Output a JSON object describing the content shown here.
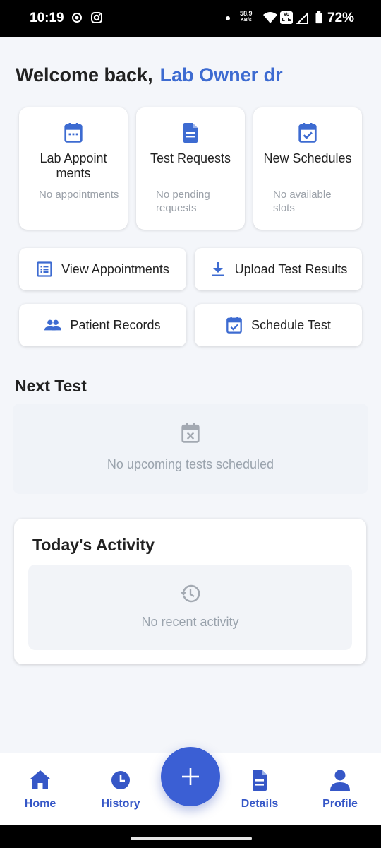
{
  "status_bar": {
    "time": "10:19",
    "net_speed_value": "58.9",
    "net_speed_unit": "KB/s",
    "volte": "Vo LTE",
    "battery": "72%"
  },
  "header": {
    "welcome_prefix": "Welcome back,",
    "user_name": "Lab Owner dr"
  },
  "stat_cards": [
    {
      "title": "Lab Appoint ments",
      "subtitle": "No appointments",
      "icon": "calendar-icon"
    },
    {
      "title": "Test Requests",
      "subtitle": "No pending requests",
      "icon": "document-icon"
    },
    {
      "title": "New Schedules",
      "subtitle": "No available slots",
      "icon": "calendar-check-icon"
    }
  ],
  "actions": [
    {
      "label": "View Appointments",
      "icon": "list-icon"
    },
    {
      "label": "Upload Test Results",
      "icon": "download-icon"
    },
    {
      "label": "Patient Records",
      "icon": "people-icon"
    },
    {
      "label": "Schedule Test",
      "icon": "calendar-check-icon"
    }
  ],
  "next_test": {
    "title": "Next Test",
    "empty_message": "No upcoming tests scheduled"
  },
  "activity": {
    "title": "Today's Activity",
    "empty_message": "No recent activity"
  },
  "bottom_nav": [
    {
      "label": "Home",
      "icon": "home-icon"
    },
    {
      "label": "History",
      "icon": "clock-icon"
    },
    {
      "label": "Details",
      "icon": "document-icon"
    },
    {
      "label": "Profile",
      "icon": "person-icon"
    }
  ],
  "fab": {
    "icon": "plus-icon"
  },
  "colors": {
    "accent": "#3d6bd1",
    "nav_active": "#3657c7",
    "fab": "#3b5fd4",
    "background": "#f4f6fa"
  }
}
